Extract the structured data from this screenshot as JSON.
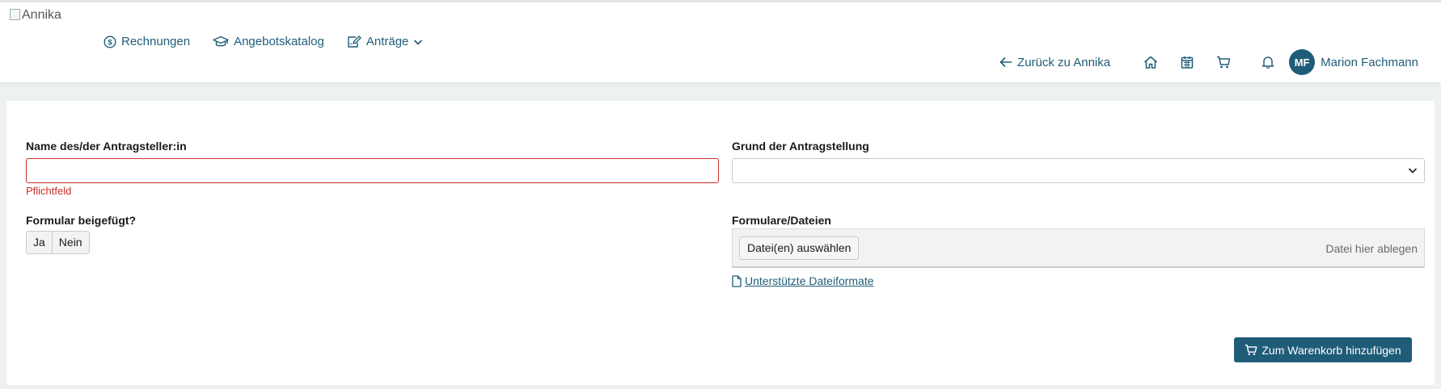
{
  "header": {
    "logo_alt": "Annika",
    "nav": [
      {
        "label": "Rechnungen",
        "icon": "dollar-circle-icon"
      },
      {
        "label": "Angebotskatalog",
        "icon": "graduation-cap-icon"
      },
      {
        "label": "Anträge",
        "icon": "edit-document-icon"
      }
    ],
    "back_label": "Zurück zu Annika",
    "user_initials": "MF",
    "user_name": "Marion Fachmann"
  },
  "form": {
    "name_label": "Name des/der Antragsteller:in",
    "name_value": "",
    "name_error": "Pflichtfeld",
    "reason_label": "Grund der Antragstellung",
    "reason_value": "",
    "attached_label": "Formular beigefügt?",
    "yes_label": "Ja",
    "no_label": "Nein",
    "files_label": "Formulare/Dateien",
    "choose_files_label": "Datei(en) auswählen",
    "drop_hint": "Datei hier ablegen",
    "formats_link": " Unterstützte Dateiformate",
    "submit_label": "Zum Warenkorb hinzufügen"
  },
  "colors": {
    "primary": "#1f5c78",
    "error": "#c9302c",
    "background": "#eef1f2"
  }
}
